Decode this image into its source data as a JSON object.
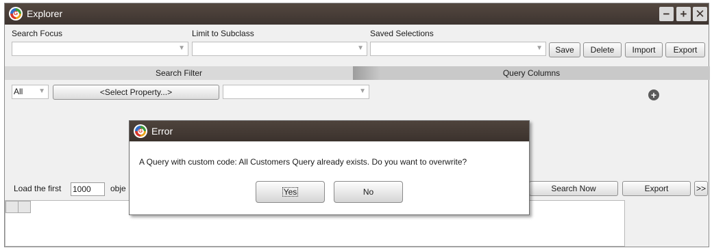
{
  "window": {
    "title": "Explorer",
    "controls": {
      "minimize": "−",
      "maximize": "+",
      "close": "✕"
    }
  },
  "top": {
    "search_focus_label": "Search Focus",
    "limit_subclass_label": "Limit to Subclass",
    "saved_selections_label": "Saved Selections",
    "search_focus_value": "",
    "limit_subclass_value": "",
    "saved_selections_value": "",
    "buttons": {
      "save": "Save",
      "delete": "Delete",
      "import": "Import",
      "export": "Export"
    }
  },
  "tabs": {
    "search_filter": "Search Filter",
    "query_columns": "Query Columns"
  },
  "filter": {
    "all_value": "All",
    "select_property": "<Select Property...>",
    "value": ""
  },
  "load": {
    "prefix": "Load the first",
    "count": "1000",
    "suffix": "obje"
  },
  "bottom_buttons": {
    "search_now": "Search Now",
    "export": "Export",
    "more": ">>"
  },
  "dialog": {
    "title": "Error",
    "message": "A Query with custom code: All Customers Query already exists. Do you want to overwrite?",
    "yes": "Yes",
    "no": "No"
  },
  "icons": {
    "arrow": "▼",
    "add": "+",
    "logo_letter": "G"
  }
}
